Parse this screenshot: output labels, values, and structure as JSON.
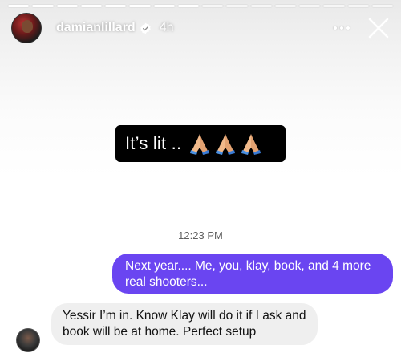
{
  "story": {
    "progress_segments": 16,
    "progress_done": 8,
    "username": "damianlillard",
    "time_ago": "4h",
    "caption_text": "It’s lit ..",
    "caption_emoji": [
      "folded-hands-emoji",
      "folded-hands-emoji",
      "folded-hands-emoji"
    ]
  },
  "chat": {
    "timestamp": "12:23 PM",
    "outgoing_message": "Next year.... Me, you, klay, book, and 4 more real shooters...",
    "incoming_message": "Yessir I’m in. Know Klay will do it if I ask and book will be at home. Perfect setup"
  },
  "colors": {
    "outgoing_bubble": "#6a45f1",
    "incoming_bubble": "#efefef",
    "verified_badge": "#ffffff",
    "caption_background": "#000000"
  }
}
